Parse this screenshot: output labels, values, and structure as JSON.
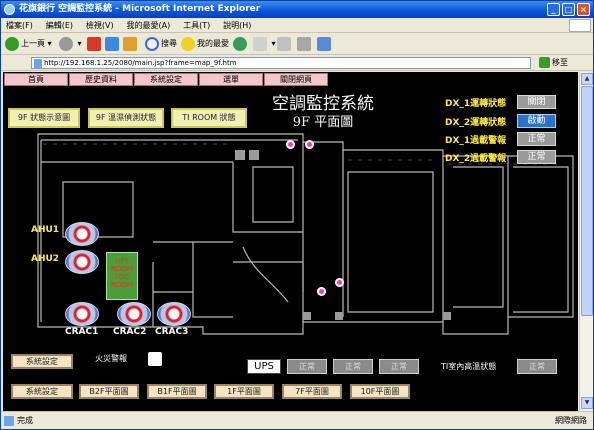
{
  "window": {
    "title": "花旗銀行 空調監控系統 - Microsoft Internet Explorer"
  },
  "menu": [
    "檔案(F)",
    "編輯(E)",
    "檢視(V)",
    "我的最愛(A)",
    "工具(T)",
    "說明(H)"
  ],
  "toolbar": {
    "back": "上一頁",
    "search": "搜尋",
    "favorites": "我的最愛"
  },
  "address": {
    "value": "http://192.168.1.25/2080/main.jsp?frame=map_9f.htm",
    "go": "移至"
  },
  "status": {
    "left": "完成",
    "zone": "網際網路"
  },
  "nav": [
    "首頁",
    "歷史資料",
    "系統設定",
    "選單",
    "關閉網頁"
  ],
  "page": {
    "title": "空調監控系統",
    "subtitle": "9F 平面圖"
  },
  "views": [
    "9F 狀態示意圖",
    "9F 溫濕偵測狀態",
    "TI ROOM 狀態"
  ],
  "dx": [
    {
      "label": "DX_1運轉狀態",
      "value": "關閉"
    },
    {
      "label": "DX_2運轉狀態",
      "value": "啟動"
    },
    {
      "label": "DX_1過載警報",
      "value": "正常"
    },
    {
      "label": "DX_2過載警報",
      "value": "正常"
    }
  ],
  "ahu": [
    "AHU1",
    "AHU2"
  ],
  "crac": [
    "CRAC1",
    "CRAC2",
    "CRAC3"
  ],
  "ups_room": [
    "UPS",
    "ROOM",
    "TOC",
    "ROOM"
  ],
  "bottom": {
    "sys_btn1": "系統設定",
    "fire": "火災警報",
    "ups": "UPS",
    "ups_status": [
      "正常",
      "正常",
      "正常"
    ],
    "ti_label": "TI室內高溫狀態",
    "ti_status": "正常",
    "sys_btn2": "系統設定"
  },
  "floors": [
    "B2F平面圖",
    "B1F平面圖",
    "1F平面圖",
    "7F平面圖",
    "10F平面圖"
  ],
  "colors": {
    "background": "#000000",
    "accent_yellow": "#ffea40",
    "active_blue": "#2c73c8",
    "alarm_pink": "#ff3aa0"
  }
}
